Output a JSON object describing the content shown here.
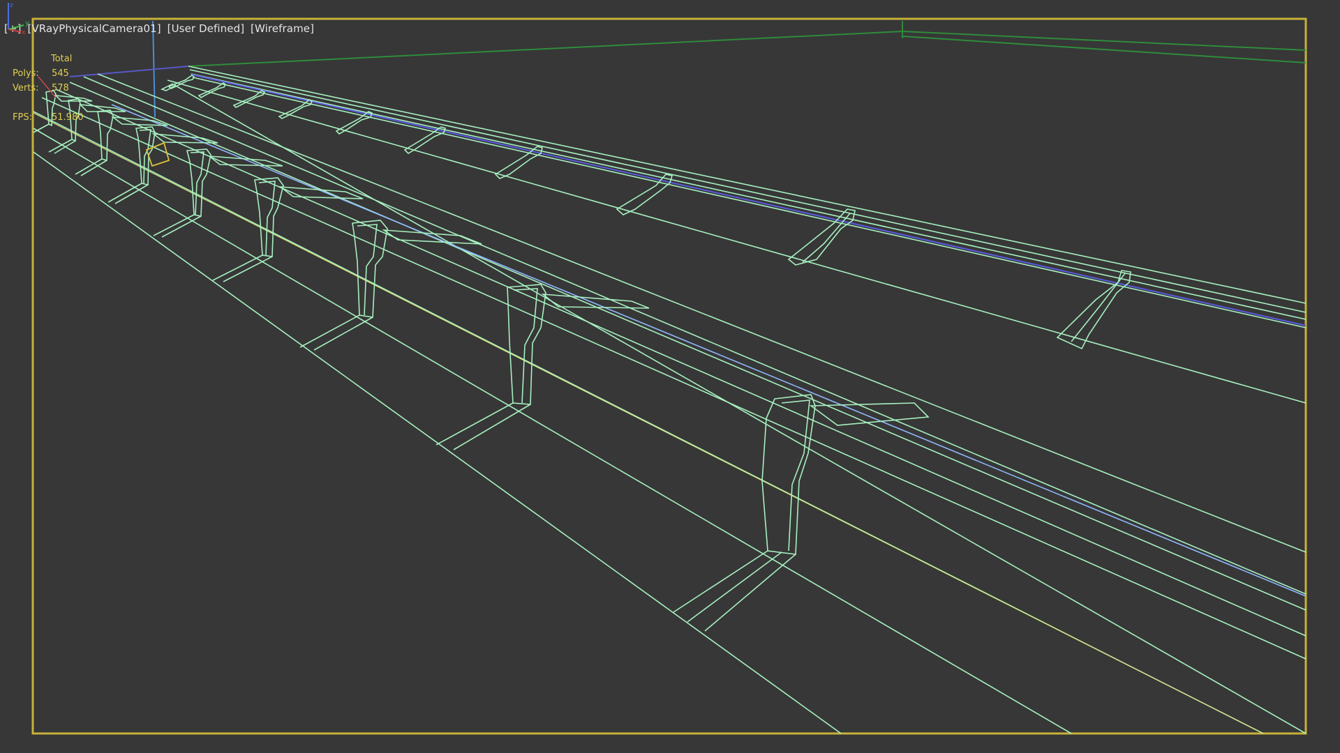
{
  "viewport": {
    "menu_plus": "[+]",
    "camera_label": "[VRayPhysicalCamera01]",
    "shading_preset_label": "[User Defined]",
    "render_mode_label": "[Wireframe]",
    "border_color": "#c7b23a",
    "wire_color": "#a7f0c0",
    "background_color": "#373737"
  },
  "stats": {
    "header": "Total",
    "polys_label": "Polys:",
    "polys_value": "545",
    "verts_label": "Verts:",
    "verts_value": "578",
    "fps_label": "FPS:",
    "fps_value": "51.980"
  },
  "axis_tripod": {
    "x_label": "x",
    "y_label": "y",
    "z_label": "z"
  }
}
